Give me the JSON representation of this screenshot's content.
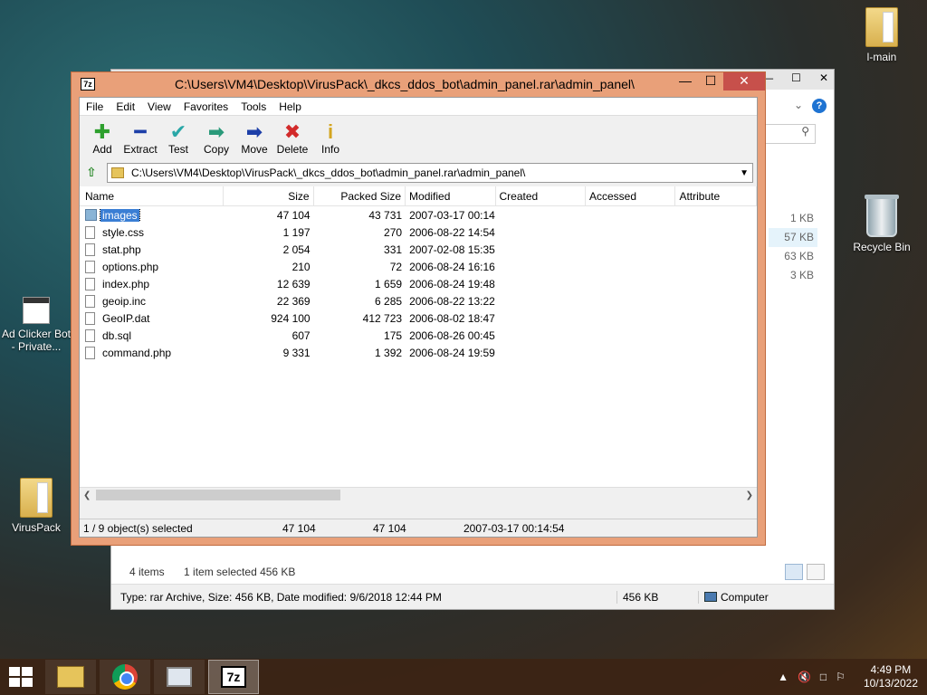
{
  "desktop": {
    "icons": [
      {
        "label": "l-main"
      },
      {
        "label": "Recycle Bin"
      },
      {
        "label": "Ad Clicker Bot - Private..."
      },
      {
        "label": "VirusPack"
      }
    ]
  },
  "explorer": {
    "title_controls": [
      "—",
      "☐",
      "✕"
    ],
    "sizes": [
      "1 KB",
      "57 KB",
      "63 KB",
      "3 KB"
    ],
    "status_items": "4 items",
    "status_selected": "1 item selected  456 KB",
    "bottom_type": "Type: rar Archive, Size: 456 KB, Date modified: 9/6/2018 12:44 PM",
    "bottom_size": "456 KB",
    "bottom_computer": "Computer"
  },
  "zip": {
    "title": "C:\\Users\\VM4\\Desktop\\VirusPack\\_dkcs_ddos_bot\\admin_panel.rar\\admin_panel\\",
    "logo": "7z",
    "menu": [
      "File",
      "Edit",
      "View",
      "Favorites",
      "Tools",
      "Help"
    ],
    "toolbar": [
      {
        "label": "Add",
        "glyph": "✚",
        "color": "#2ea02e",
        "icon": "add-icon"
      },
      {
        "label": "Extract",
        "glyph": "━",
        "color": "#1d3fa8",
        "icon": "extract-icon"
      },
      {
        "label": "Test",
        "glyph": "✔",
        "color": "#2aa7a7",
        "icon": "test-icon"
      },
      {
        "label": "Copy",
        "glyph": "➡",
        "color": "#2a9a7a",
        "icon": "copy-icon"
      },
      {
        "label": "Move",
        "glyph": "➡",
        "color": "#1d3fa8",
        "icon": "move-icon"
      },
      {
        "label": "Delete",
        "glyph": "✖",
        "color": "#d22a2a",
        "icon": "delete-icon"
      },
      {
        "label": "Info",
        "glyph": "i",
        "color": "#d4a520",
        "icon": "info-icon"
      }
    ],
    "address": "C:\\Users\\VM4\\Desktop\\VirusPack\\_dkcs_ddos_bot\\admin_panel.rar\\admin_panel\\",
    "columns": [
      "Name",
      "Size",
      "Packed Size",
      "Modified",
      "Created",
      "Accessed",
      "Attribute"
    ],
    "rows": [
      {
        "name": "images",
        "size": "47 104",
        "packed": "43 731",
        "modified": "2007-03-17 00:14",
        "folder": true,
        "selected": true
      },
      {
        "name": "style.css",
        "size": "1 197",
        "packed": "270",
        "modified": "2006-08-22 14:54"
      },
      {
        "name": "stat.php",
        "size": "2 054",
        "packed": "331",
        "modified": "2007-02-08 15:35"
      },
      {
        "name": "options.php",
        "size": "210",
        "packed": "72",
        "modified": "2006-08-24 16:16"
      },
      {
        "name": "index.php",
        "size": "12 639",
        "packed": "1 659",
        "modified": "2006-08-24 19:48"
      },
      {
        "name": "geoip.inc",
        "size": "22 369",
        "packed": "6 285",
        "modified": "2006-08-22 13:22"
      },
      {
        "name": "GeoIP.dat",
        "size": "924 100",
        "packed": "412 723",
        "modified": "2006-08-02 18:47"
      },
      {
        "name": "db.sql",
        "size": "607",
        "packed": "175",
        "modified": "2006-08-26 00:45"
      },
      {
        "name": "command.php",
        "size": "9 331",
        "packed": "1 392",
        "modified": "2006-08-24 19:59"
      }
    ],
    "status": {
      "selected": "1 / 9 object(s) selected",
      "size": "47 104",
      "packed": "47 104",
      "modified": "2007-03-17 00:14:54"
    }
  },
  "taskbar": {
    "time": "4:49 PM",
    "date": "10/13/2022"
  }
}
